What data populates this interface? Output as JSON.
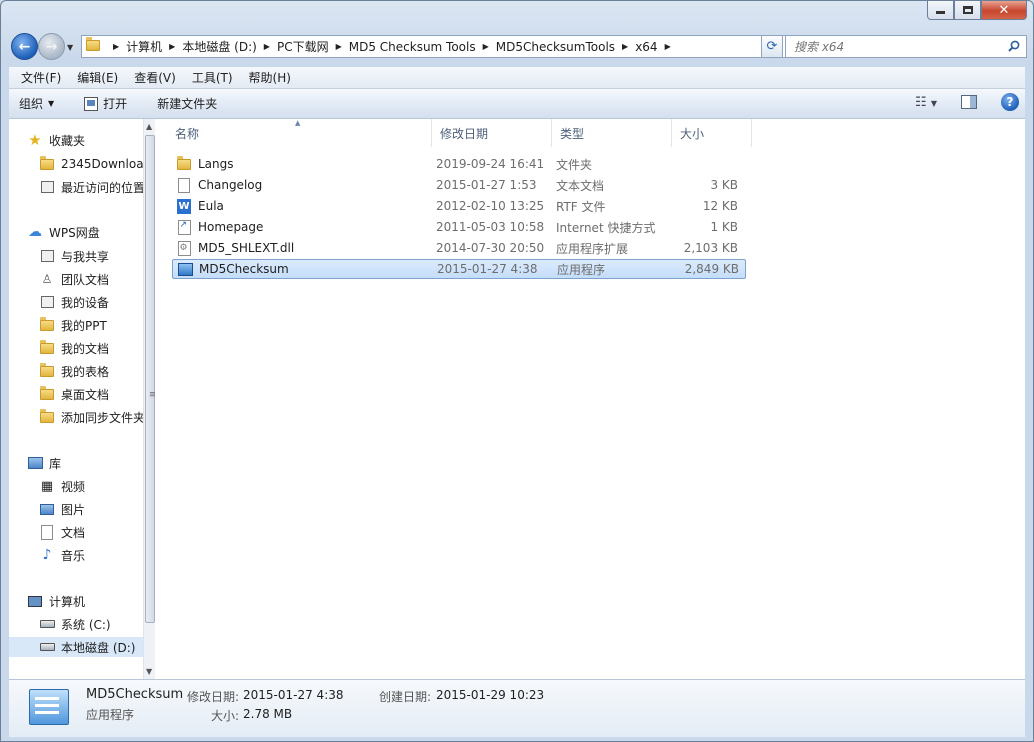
{
  "window": {
    "minimize_label": "–",
    "maximize_label": "□",
    "close_label": "✕"
  },
  "address": {
    "crumbs": [
      "计算机",
      "本地磁盘 (D:)",
      "PC下载网",
      "MD5 Checksum Tools",
      "MD5ChecksumTools",
      "x64"
    ]
  },
  "search": {
    "placeholder": "搜索 x64"
  },
  "menu": [
    "文件(F)",
    "编辑(E)",
    "查看(V)",
    "工具(T)",
    "帮助(H)"
  ],
  "toolbar": {
    "organize": "组织",
    "open": "打开",
    "new_folder": "新建文件夹"
  },
  "nav": {
    "favorites": "收藏夹",
    "fav_items": [
      "2345Downloa",
      "最近访问的位置"
    ],
    "wps": "WPS网盘",
    "wps_items": [
      "与我共享",
      "团队文档",
      "我的设备",
      "我的PPT",
      "我的文档",
      "我的表格",
      "桌面文档",
      "添加同步文件夹"
    ],
    "libraries": "库",
    "lib_items": [
      "视频",
      "图片",
      "文档",
      "音乐"
    ],
    "computer": "计算机",
    "drives": [
      "系统 (C:)",
      "本地磁盘 (D:)"
    ]
  },
  "columns": {
    "name": "名称",
    "date": "修改日期",
    "type": "类型",
    "size": "大小"
  },
  "files": [
    {
      "name": "Langs",
      "date": "2019-09-24 16:41",
      "type": "文件夹",
      "size": "",
      "icon": "folder-icon"
    },
    {
      "name": "Changelog",
      "date": "2015-01-27 1:53",
      "type": "文本文档",
      "size": "3 KB",
      "icon": "text-file-icon"
    },
    {
      "name": "Eula",
      "date": "2012-02-10 13:25",
      "type": "RTF 文件",
      "size": "12 KB",
      "icon": "rtf-file-icon"
    },
    {
      "name": "Homepage",
      "date": "2011-05-03 10:58",
      "type": "Internet 快捷方式",
      "size": "1 KB",
      "icon": "shortcut-icon"
    },
    {
      "name": "MD5_SHLEXT.dll",
      "date": "2014-07-30 20:50",
      "type": "应用程序扩展",
      "size": "2,103 KB",
      "icon": "dll-icon"
    },
    {
      "name": "MD5Checksum",
      "date": "2015-01-27 4:38",
      "type": "应用程序",
      "size": "2,849 KB",
      "icon": "application-icon"
    }
  ],
  "details": {
    "name": "MD5Checksum",
    "kind": "应用程序",
    "modified_label": "修改日期:",
    "modified": "2015-01-27 4:38",
    "created_label": "创建日期:",
    "created": "2015-01-29 10:23",
    "size_label": "大小:",
    "size": "2.78 MB"
  }
}
